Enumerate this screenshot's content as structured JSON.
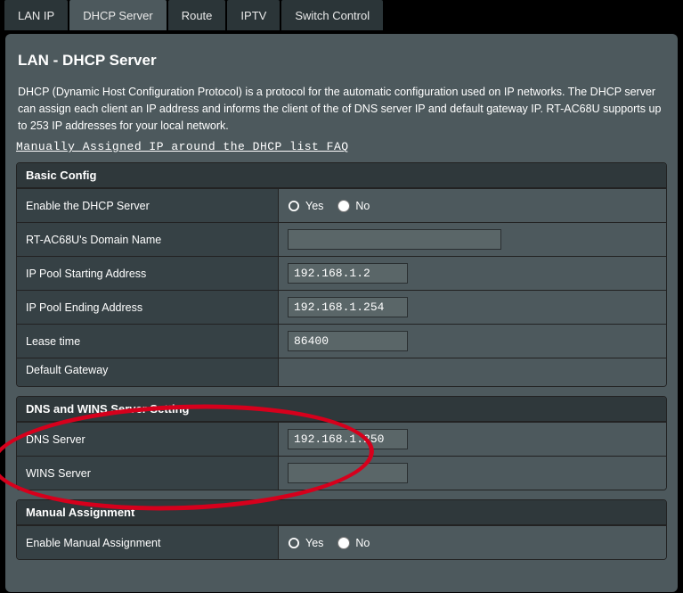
{
  "tabs": {
    "lan_ip": "LAN IP",
    "dhcp": "DHCP Server",
    "route": "Route",
    "iptv": "IPTV",
    "switch": "Switch Control"
  },
  "page_title": "LAN - DHCP Server",
  "description": "DHCP (Dynamic Host Configuration Protocol) is a protocol for the automatic configuration used on IP networks. The DHCP server can assign each client an IP address and informs the client of the of DNS server IP and default gateway IP. RT-AC68U supports up to 253 IP addresses for your local network.",
  "faq_link": "Manually Assigned IP around the DHCP list FAQ",
  "sections": {
    "basic": {
      "header": "Basic Config",
      "enable_label": "Enable the DHCP Server",
      "yes": "Yes",
      "no": "No",
      "domain_label": "RT-AC68U's Domain Name",
      "domain_value": "",
      "start_label": "IP Pool Starting Address",
      "start_value": "192.168.1.2",
      "end_label": "IP Pool Ending Address",
      "end_value": "192.168.1.254",
      "lease_label": "Lease time",
      "lease_value": "86400",
      "gateway_label": "Default Gateway",
      "gateway_value": ""
    },
    "dns": {
      "header": "DNS and WINS Server Setting",
      "dns_label": "DNS Server",
      "dns_value": "192.168.1.250",
      "wins_label": "WINS Server",
      "wins_value": ""
    },
    "manual": {
      "header": "Manual Assignment",
      "enable_label": "Enable Manual Assignment",
      "yes": "Yes",
      "no": "No"
    }
  }
}
